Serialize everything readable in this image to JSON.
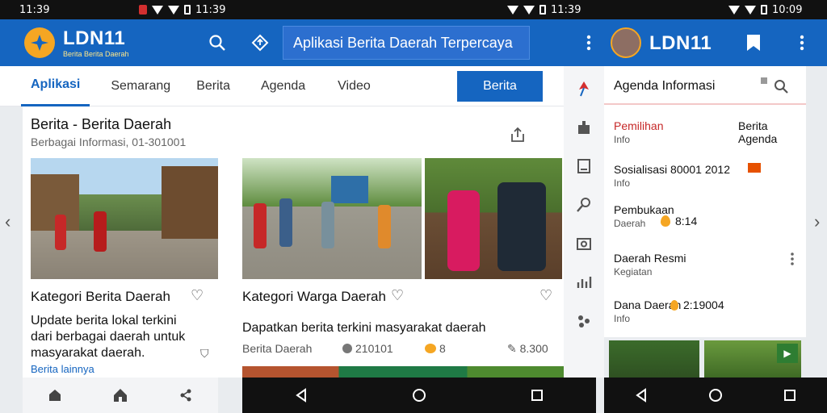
{
  "status_left": {
    "time": "11:39"
  },
  "status_mid": {
    "time": "11:39"
  },
  "status_right": {
    "time": "10:09"
  },
  "header": {
    "brand": "LDN11",
    "tagline": "Berita Berita Daerah",
    "banner": "Aplikasi Berita Daerah Terpercaya",
    "right_brand": "LDN11"
  },
  "tabs": {
    "items": [
      "Aplikasi",
      "Semarang",
      "Berita",
      "Agenda",
      "Video"
    ],
    "action": "Berita"
  },
  "article": {
    "title": "Berita - Berita Daerah",
    "meta": "Berbagai Informasi, 01-301001"
  },
  "cards": [
    {
      "caption": "Kategori Berita Daerah",
      "desc_lines": [
        "Update berita lokal terkini",
        "dari berbagai daerah untuk",
        "masyarakat daerah."
      ],
      "link": "Berita lainnya"
    },
    {
      "caption": "Kategori Warga Daerah",
      "desc": "Dapatkan berita terkini masyarakat daerah",
      "footer_left": "Berita Daerah",
      "footer_mid": "210101",
      "footer_count": "8",
      "footer_right": "8.300"
    }
  ],
  "panel": {
    "search_label": "Agenda Informasi",
    "items": [
      {
        "title": "Pemilihan",
        "right": "Berita Agenda",
        "sub": "Info",
        "accent": "#c62828"
      },
      {
        "title": "Sosialisasi 80001 2012",
        "right": "",
        "sub": "Info"
      },
      {
        "title": "Pembukaan",
        "right": "",
        "sub": "Daerah",
        "value": "8:14"
      },
      {
        "title": "Daerah Resmi",
        "right": "",
        "sub": "Kegiatan"
      },
      {
        "title": "Dana Daerah",
        "right": "",
        "sub": "Info",
        "value": "2:19004"
      }
    ]
  },
  "colors": {
    "primary": "#1565c0",
    "accent": "#f5a623",
    "badge": "#e65100"
  },
  "icons": {
    "search": "search-icon",
    "share": "share-icon",
    "heart": "heart-icon",
    "home": "home-icon",
    "more": "more-vert-icon"
  }
}
